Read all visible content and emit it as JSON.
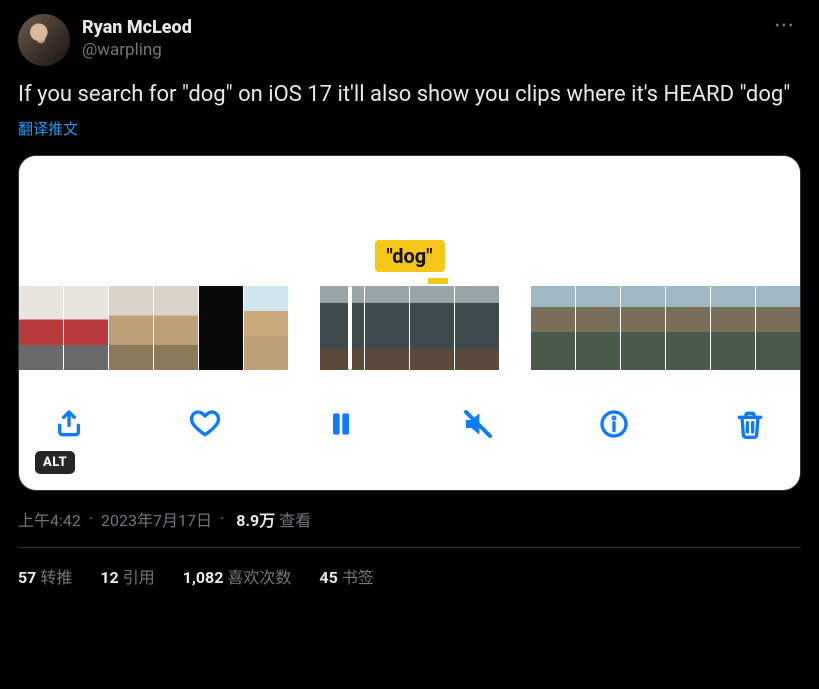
{
  "author": {
    "display_name": "Ryan McLeod",
    "handle": "@warpling"
  },
  "tweet_text": "If you search for \"dog\" on iOS 17 it'll also show you clips where it's HEARD \"dog\"",
  "translate_label": "翻译推文",
  "media": {
    "highlight_word": "\"dog\"",
    "alt_badge": "ALT"
  },
  "meta": {
    "time": "上午4:42",
    "date": "2023年7月17日",
    "views_count": "8.9万",
    "views_label": "查看"
  },
  "stats": {
    "retweets": {
      "count": "57",
      "label": "转推"
    },
    "quotes": {
      "count": "12",
      "label": "引用"
    },
    "likes": {
      "count": "1,082",
      "label": "喜欢次数"
    },
    "bookmarks": {
      "count": "45",
      "label": "书签"
    }
  }
}
